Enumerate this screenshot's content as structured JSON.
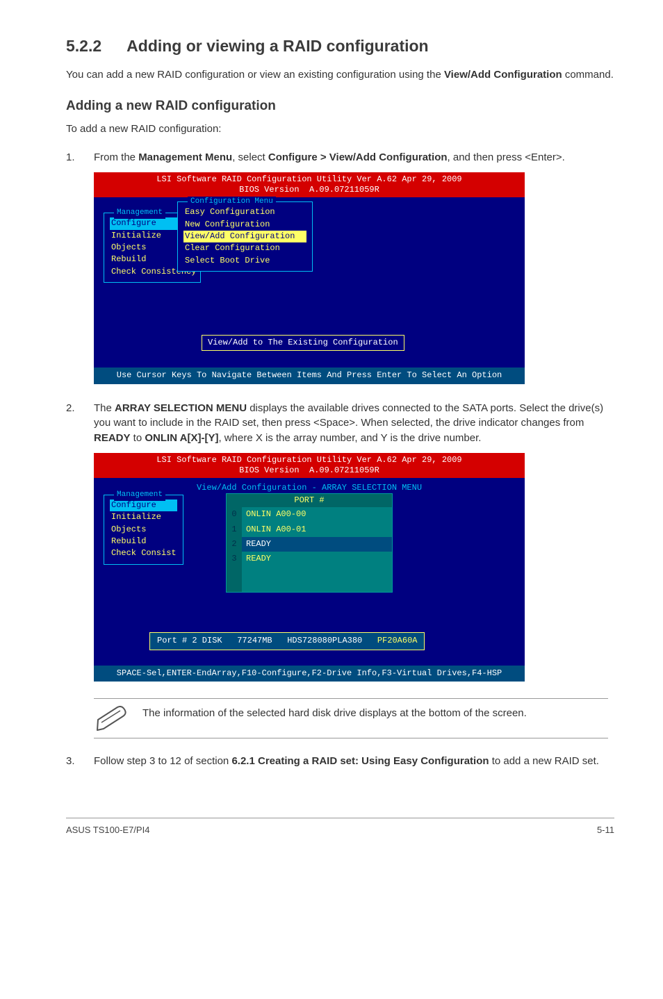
{
  "heading": {
    "number": "5.2.2",
    "title": "Adding or viewing a RAID configuration"
  },
  "intro": {
    "pre": "You can add a new RAID configuration or view an existing configuration using the ",
    "bold": "View/Add Configuration",
    "post": " command."
  },
  "subheading": "Adding a new RAID configuration",
  "lead": "To add a new RAID configuration:",
  "step1": {
    "num": "1.",
    "t1": "From the ",
    "b1": "Management Menu",
    "t2": ", select ",
    "b2": "Configure > View/Add Configuration",
    "t3": ", and then press <Enter>."
  },
  "bios1": {
    "title_l1": "LSI Software RAID Configuration Utility Ver A.62 Apr 29, 2009",
    "title_l2": "BIOS Version  A.09.07211059R",
    "mgmt_title": "Management",
    "mgmt_items": [
      "Configure",
      "Initialize",
      "Objects",
      "Rebuild",
      "Check Consistency"
    ],
    "cfg_title": "Configuration Menu",
    "cfg_items": [
      "Easy Configuration",
      "New Configuration",
      "View/Add Configuration",
      "Clear Configuration",
      "Select Boot Drive"
    ],
    "hint": "View/Add to The Existing Configuration",
    "footer": "Use Cursor Keys To Navigate Between Items And Press Enter To Select An Option"
  },
  "step2": {
    "num": "2.",
    "t1": "The ",
    "b1": "ARRAY SELECTION MENU",
    "t2": " displays the available drives connected to the SATA ports. Select the drive(s) you want to include in the RAID set, then press <Space>. When selected, the drive indicator changes from ",
    "b2": "READY",
    "t3": " to ",
    "b3": "ONLIN A[X]-[Y]",
    "t4": ", where X is the array number, and Y is the drive number."
  },
  "bios2": {
    "title_l1": "LSI Software RAID Configuration Utility Ver A.62 Apr 29, 2009",
    "title_l2": "BIOS Version  A.09.07211059R",
    "va_title": "View/Add Configuration - ARRAY SELECTION MENU",
    "mgmt_title": "Management",
    "mgmt_items": [
      "Configure",
      "Initialize",
      "Objects",
      "Rebuild",
      "Check Consist"
    ],
    "port_header": "PORT #",
    "rows": [
      {
        "idx": "0",
        "val": "ONLIN A00-00"
      },
      {
        "idx": "1",
        "val": "ONLIN A00-01"
      },
      {
        "idx": "2",
        "val": "READY"
      },
      {
        "idx": "3",
        "val": "READY"
      }
    ],
    "port_pre": "Port # 2 DISK   77247MB   HDS728080PLA380   ",
    "port_hot": "PF20A60A",
    "footer": "SPACE-Sel,ENTER-EndArray,F10-Configure,F2-Drive Info,F3-Virtual Drives,F4-HSP"
  },
  "note": "The information of the selected hard disk drive displays at the bottom of the screen.",
  "step3": {
    "num": "3.",
    "t1": "Follow step 3 to 12 of section ",
    "b1": "6.2.1 Creating a RAID set: Using Easy Configuration",
    "t2": " to add a new RAID set."
  },
  "footer": {
    "left": "ASUS TS100-E7/PI4",
    "right": "5-11"
  }
}
